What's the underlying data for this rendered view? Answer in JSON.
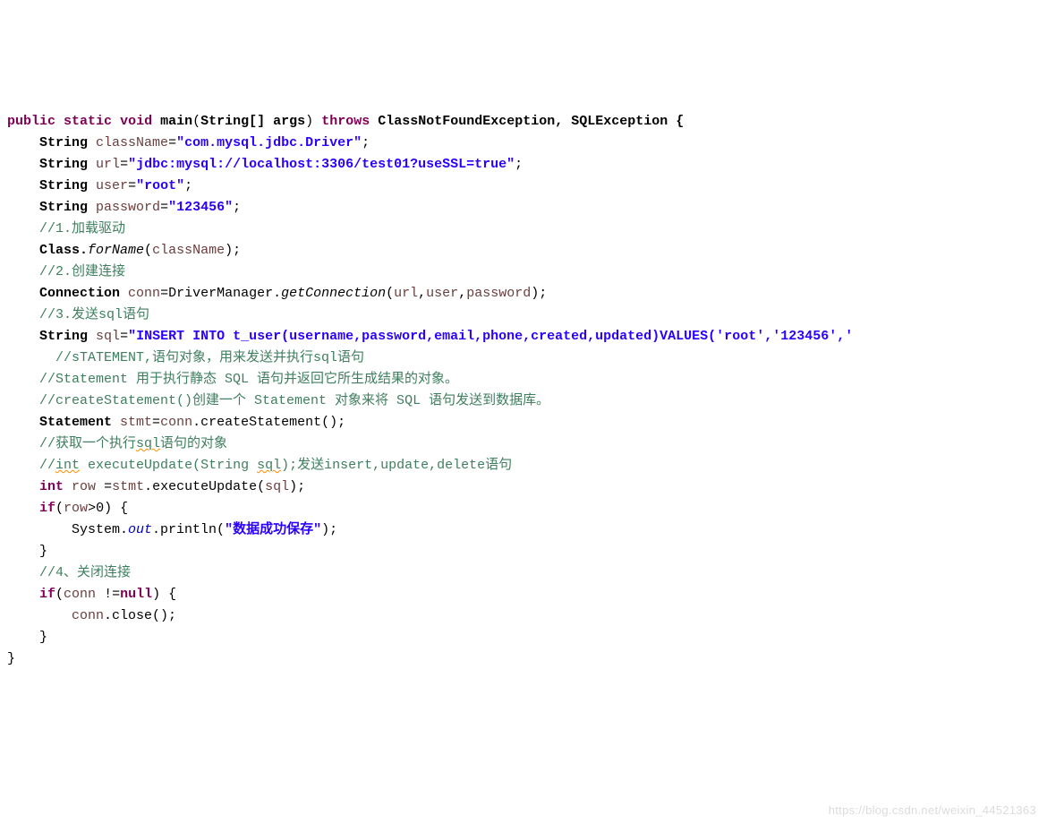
{
  "code": {
    "line1_kw_pub": "public",
    "line1_kw_static": "static",
    "line1_kw_void": "void",
    "line1_main": "main",
    "line1_paren_open": "(",
    "line1_argtype": "String[] args",
    "line1_paren_close": ")",
    "line1_kw_throws": "throws",
    "line1_exc": "ClassNotFoundException, SQLException {",
    "l2_type": "String",
    "l2_var": "className",
    "l2_eq": "=",
    "l2_str": "\"com.mysql.jdbc.Driver\"",
    "l2_semi": ";",
    "l3_type": "String",
    "l3_var": "url",
    "l3_eq": "=",
    "l3_str": "\"jdbc:mysql://localhost:3306/test01?useSSL=true\"",
    "l3_semi": ";",
    "l4_type": "String",
    "l4_var": "user",
    "l4_eq": "=",
    "l4_str": "\"root\"",
    "l4_semi": ";",
    "l5_type": "String",
    "l5_var": "password",
    "l5_eq": "=",
    "l5_str": "\"123456\"",
    "l5_semi": ";",
    "l6_cmt": "//1.加载驱动",
    "l7_cls": "Class.",
    "l7_forName": "forName",
    "l7_open": "(",
    "l7_arg": "className",
    "l7_close": ");",
    "l8_cmt": "//2.创建连接",
    "l9_type": "Connection ",
    "l9_var": "conn",
    "l9_eq": "=DriverManager.",
    "l9_call": "getConnection",
    "l9_open": "(",
    "l9_a1": "url",
    "l9_c1": ",",
    "l9_a2": "user",
    "l9_c2": ",",
    "l9_a3": "password",
    "l9_close": ");",
    "l10_cmt": "//3.发送sql语句",
    "l11_type": "String",
    "l11_var": "sql",
    "l11_eq": "=",
    "l11_str": "\"INSERT INTO t_user(username,password,email,phone,created,updated)VALUES('root','123456','",
    "l12_cmt": "  //sTATEMENT,语句对象，用来发送并执行sql语句",
    "l13_cmt": "//Statement 用于执行静态 SQL 语句并返回它所生成结果的对象。",
    "l14_cmt": "//createStatement()创建一个 Statement 对象来将 SQL 语句发送到数据库。",
    "l15_type": "Statement ",
    "l15_var": "stmt",
    "l15_eq": "=",
    "l15_conn": "conn",
    "l15_dot": ".createStatement();",
    "l16_cmt_a": "//获取一个执行",
    "l16_cmt_u": "sql",
    "l16_cmt_b": "语句的对象",
    "l17_cmt_a": "//",
    "l17_cmt_u1": "int",
    "l17_cmt_sp1": " executeUpdate(String ",
    "l17_cmt_u2": "sql",
    "l17_cmt_b": ");发送insert,update,delete语句",
    "l18_kw": "int",
    "l18_var": "row",
    "l18_sp": " =",
    "l18_stmt": "stmt",
    "l18_call": ".executeUpdate(",
    "l18_arg": "sql",
    "l18_close": ");",
    "l19_kw": "if",
    "l19_open": "(",
    "l19_row": "row",
    "l19_gt": ">",
    "l19_zero": "0",
    "l19_close": ") {",
    "l20_sys": "System.",
    "l20_out": "out",
    "l20_call": ".println(",
    "l20_str": "\"数据成功保存\"",
    "l20_close": ");",
    "l21_brace": "}",
    "l22_cmt": "//4、关闭连接",
    "l23_kw": "if",
    "l23_open": "(",
    "l23_conn": "conn",
    "l23_ne": " !=",
    "l23_null": "null",
    "l23_close": ") {",
    "l24_conn": "conn",
    "l24_call": ".close();",
    "l25_brace": "}",
    "l26_brace": "}"
  },
  "watermark": "https://blog.csdn.net/weixin_44521363"
}
